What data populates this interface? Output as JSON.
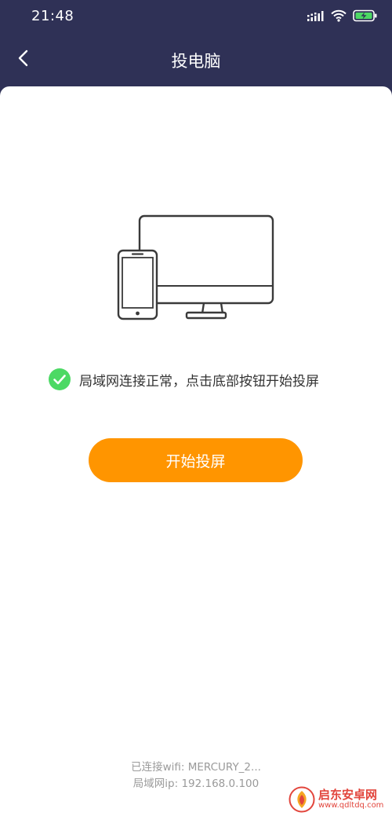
{
  "status_bar": {
    "time": "21:48",
    "icons": [
      "signal-icon",
      "wifi-icon",
      "battery-charging-icon"
    ]
  },
  "header": {
    "title": "投电脑",
    "back_icon": "chevron-left-icon"
  },
  "main": {
    "illustration": "phone-and-monitor-icon",
    "status_icon": "check-circle-icon",
    "status_message": "局域网连接正常，点击底部按钮开始投屏",
    "start_button_label": "开始投屏"
  },
  "footer": {
    "wifi_line": "已连接wifi: MERCURY_2...",
    "ip_line": "局域网ip: 192.168.0.100"
  },
  "watermark": {
    "name": "启东安卓网",
    "url": "www.qdltdq.com"
  },
  "colors": {
    "header_bg": "#2f3156",
    "accent": "#ff9500",
    "success": "#4cd964",
    "footer_text": "#9a9a9a"
  }
}
